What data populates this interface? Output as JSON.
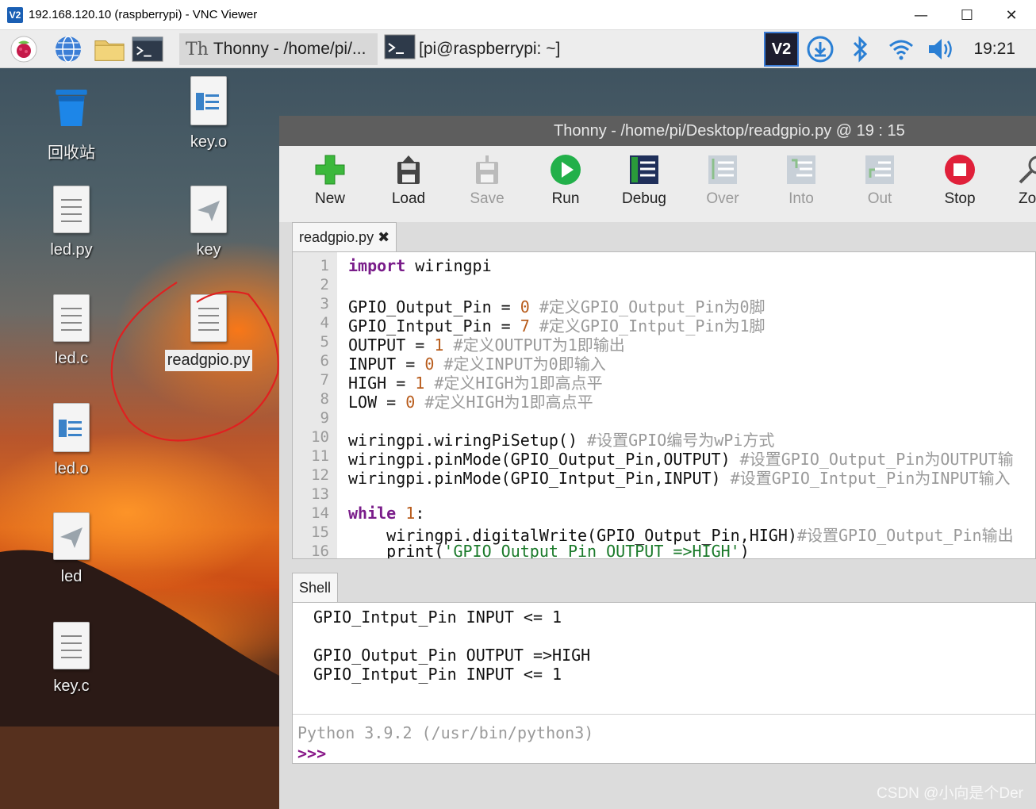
{
  "vnc": {
    "title": "192.168.120.10 (raspberrypi) - VNC Viewer",
    "logo": "V2",
    "minimize": "—",
    "maximize": "☐",
    "close": "✕"
  },
  "panel": {
    "tasks": [
      {
        "label": "Thonny  -  /home/pi/...",
        "icon": "thonny-icon"
      },
      {
        "label": "[pi@raspberrypi: ~]",
        "icon": "terminal-icon"
      }
    ],
    "tray_logo": "V2",
    "clock": "19:21"
  },
  "desktop": {
    "icons": [
      {
        "label": "回收站"
      },
      {
        "label": "key.o"
      },
      {
        "label": "led.py"
      },
      {
        "label": "key"
      },
      {
        "label": "led.c"
      },
      {
        "label": "readgpio.py"
      },
      {
        "label": "led.o"
      },
      {
        "label": "led"
      },
      {
        "label": "key.c"
      }
    ]
  },
  "thonny": {
    "title": "Thonny  -  /home/pi/Desktop/readgpio.py  @  19 : 15",
    "toolbar": [
      "New",
      "Load",
      "Save",
      "Run",
      "Debug",
      "Over",
      "Into",
      "Out",
      "Stop",
      "Zo"
    ],
    "editor_tab": "readgpio.py ✖",
    "lines": [
      "1",
      "2",
      "3",
      "4",
      "5",
      "6",
      "7",
      "8",
      "9",
      "10",
      "11",
      "12",
      "13",
      "14",
      "15",
      "16"
    ],
    "code": {
      "l1_kw": "import",
      "l1_rest": " wiringpi",
      "l3_a": "GPIO_Output_Pin = ",
      "l3_n": "0",
      "l3_c": " #定义GPIO_Output_Pin为0脚",
      "l4_a": "GPIO_Intput_Pin = ",
      "l4_n": "7",
      "l4_c": " #定义GPIO_Intput_Pin为1脚",
      "l5_a": "OUTPUT = ",
      "l5_n": "1",
      "l5_c": " #定义OUTPUT为1即输出",
      "l6_a": "INPUT = ",
      "l6_n": "0",
      "l6_c": " #定义INPUT为0即输入",
      "l7_a": "HIGH = ",
      "l7_n": "1",
      "l7_c": " #定义HIGH为1即高点平",
      "l8_a": "LOW = ",
      "l8_n": "0",
      "l8_c": " #定义HIGH为1即高点平",
      "l10_a": "wiringpi.wiringPiSetup()",
      "l10_c": " #设置GPIO编号为wPi方式",
      "l11_a": "wiringpi.pinMode(GPIO_Output_Pin,OUTPUT)",
      "l11_c": " #设置GPIO_Output_Pin为OUTPUT输",
      "l12_a": "wiringpi.pinMode(GPIO_Intput_Pin,INPUT)",
      "l12_c": " #设置GPIO_Intput_Pin为INPUT输入",
      "l14_kw": "while",
      "l14_n": " 1",
      "l14_r": ":",
      "l15_a": "    wiringpi.digitalWrite(GPIO_Output_Pin,HIGH)",
      "l15_c": "#设置GPIO_Output_Pin输出",
      "l16_a": "    print(",
      "l16_s": "'GPIO_Output_Pin OUTPUT =>HIGH'",
      "l16_r": ")"
    },
    "shell_tab": "Shell",
    "shell": [
      "GPIO_Intput_Pin INPUT <= 1",
      "GPIO_Output_Pin OUTPUT =>HIGH",
      "GPIO_Intput_Pin INPUT <= 1"
    ],
    "python_info": "Python 3.9.2 (/usr/bin/python3)",
    "prompt": ">>>"
  },
  "watermark": "CSDN @小向是个Der"
}
